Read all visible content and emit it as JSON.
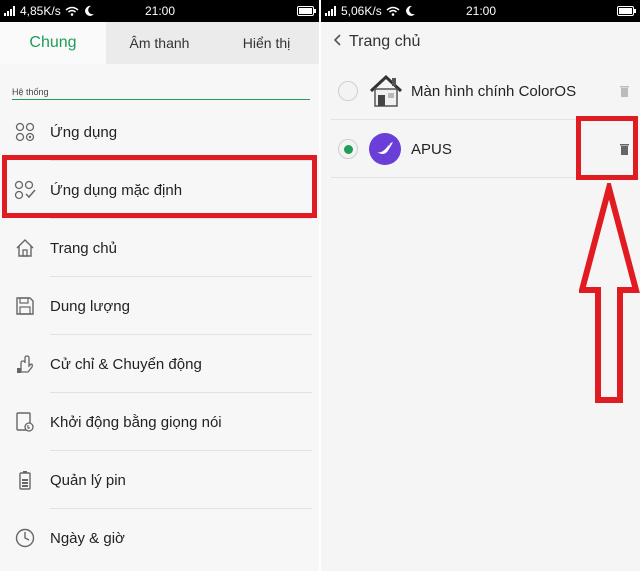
{
  "left_statusbar": {
    "speed": "4,85K/s",
    "time": "21:00"
  },
  "right_statusbar": {
    "speed": "5,06K/s",
    "time": "21:00"
  },
  "tabs": [
    {
      "label": "Chung",
      "active": true
    },
    {
      "label": "Âm thanh",
      "active": false
    },
    {
      "label": "Hiển thị",
      "active": false
    }
  ],
  "section_header": "Hệ thống",
  "menu": [
    {
      "label": "Ứng dụng",
      "icon": "apps-icon"
    },
    {
      "label": "Ứng dụng mặc định",
      "icon": "default-apps-icon"
    },
    {
      "label": "Trang chủ",
      "icon": "home-icon"
    },
    {
      "label": "Dung lượng",
      "icon": "storage-icon"
    },
    {
      "label": "Cử chỉ & Chuyển động",
      "icon": "gesture-icon"
    },
    {
      "label": "Khởi động bằng giọng nói",
      "icon": "voice-icon"
    },
    {
      "label": "Quản lý pin",
      "icon": "battery-icon"
    },
    {
      "label": "Ngày & giờ",
      "icon": "clock-icon"
    }
  ],
  "right_header": {
    "title": "Trang chủ"
  },
  "launchers": [
    {
      "label": "Màn hình chính ColorOS",
      "selected": false,
      "icon": "house-icon"
    },
    {
      "label": "APUS",
      "selected": true,
      "icon": "apus-icon"
    }
  ],
  "colors": {
    "accent": "#1e9e57",
    "highlight": "#e11b22"
  }
}
